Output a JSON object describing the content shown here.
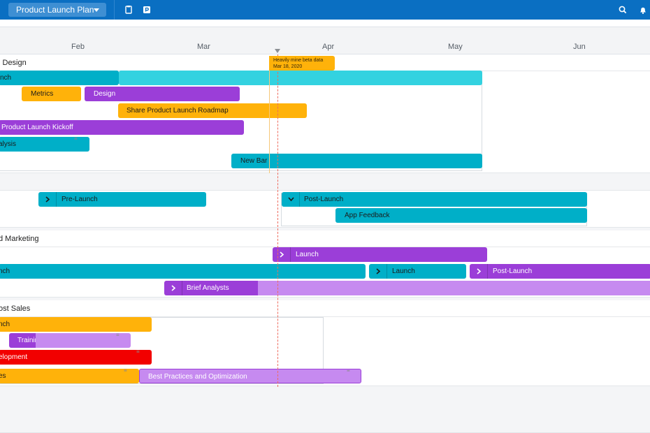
{
  "topbar": {
    "plan_title": "Product Launch Plan",
    "icons": [
      "clipboard-icon",
      "presentation-icon",
      "search-icon",
      "bell-icon"
    ]
  },
  "timeline": {
    "months": [
      "Feb",
      "Mar",
      "Apr",
      "May",
      "Jun"
    ],
    "today_marker": {
      "date": "Mar 18, 2020"
    },
    "milestone": {
      "title": "Heavily mine beta data",
      "date": "Mar 18, 2020"
    }
  },
  "colors": {
    "teal": "#00afc8",
    "teal_light": "#33d2e0",
    "purple": "#9b3ed8",
    "purple_light": "#c68af0",
    "orange": "#ffb20a",
    "red": "#f20000",
    "header_blue": "#0a6fc2"
  },
  "swimlanes": [
    {
      "name": "l Design",
      "bars": [
        "nch",
        "Metrics",
        "Design",
        "Share Product Launch Roadmap",
        "Product Launch Kickoff",
        "alysis",
        "New Bar"
      ]
    },
    {
      "name": "",
      "bars": [
        "Pre-Launch",
        "Post-Launch",
        "App Feedback"
      ]
    },
    {
      "name": "d Marketing",
      "bars": [
        "Launch",
        "nch",
        "Launch",
        "Post-Launch",
        "Brief Analysts"
      ]
    },
    {
      "name": "ost Sales",
      "bars": [
        "nch",
        "Training",
        "elopment",
        "es",
        "Best Practices and Optimization"
      ]
    }
  ]
}
